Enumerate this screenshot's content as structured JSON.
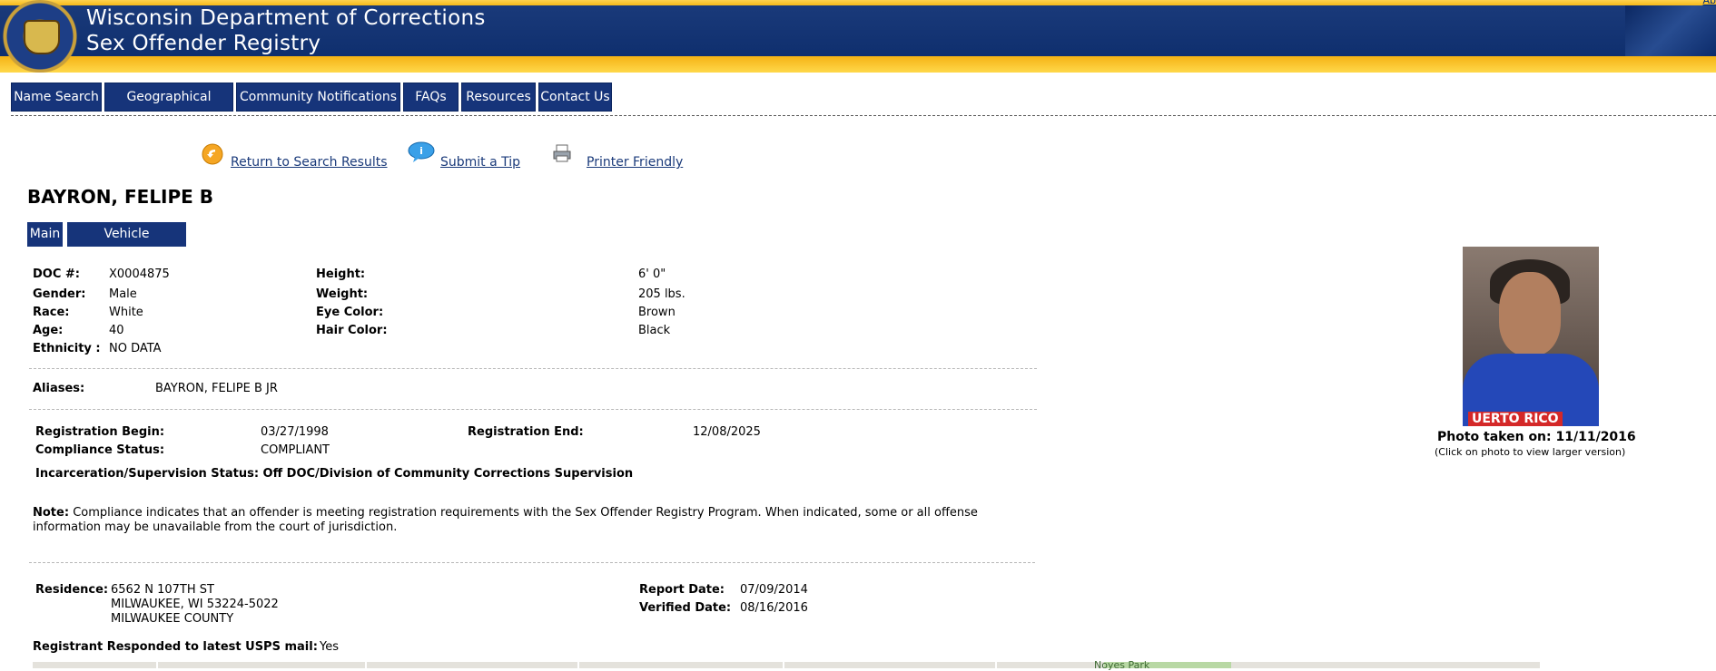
{
  "header": {
    "title_line1": "Wisconsin Department of Corrections",
    "title_line2": "Sex Offender Registry",
    "corner_link": "Ab",
    "colors": {
      "bar": "#0f2f6e",
      "stripe": "#f5b315"
    }
  },
  "nav": {
    "items": [
      "Name Search",
      "Geographical Search",
      "Community Notifications",
      "FAQs",
      "Resources",
      "Contact Us"
    ]
  },
  "actions": {
    "return_label": "Return to Search Results",
    "tip_label": "Submit a Tip",
    "print_label": "Printer Friendly"
  },
  "offender": {
    "name": "BAYRON, FELIPE B",
    "tabs": [
      "Main",
      "Vehicle Information"
    ],
    "doc_label": "DOC #:",
    "doc": "X0004875",
    "gender_label": "Gender:",
    "gender": "Male",
    "race_label": "Race:",
    "race": "White",
    "age_label": "Age:",
    "age": "40",
    "ethnicity_label": "Ethnicity :",
    "ethnicity": "NO DATA",
    "height_label": "Height:",
    "height": "6' 0\"",
    "weight_label": "Weight:",
    "weight": "205 lbs.",
    "eye_label": "Eye Color:",
    "eye": "Brown",
    "hair_label": "Hair Color:",
    "hair": "Black",
    "aliases_label": "Aliases:",
    "aliases": "BAYRON, FELIPE B JR",
    "reg_begin_label": "Registration Begin:",
    "reg_begin": "03/27/1998",
    "reg_end_label": "Registration End:",
    "reg_end": "12/08/2025",
    "compliance_label": "Compliance Status:",
    "compliance": "COMPLIANT",
    "incarceration": "Incarceration/Supervision Status: Off DOC/Division of Community Corrections Supervision",
    "note_label": "Note:",
    "note_line1": "Compliance indicates that an offender is meeting registration requirements with the Sex Offender Registry Program. When indicated, some or all offense",
    "note_line2": "information may be unavailable from the court of jurisdiction.",
    "residence_label": "Residence:",
    "residence_line1": "6562 N 107TH ST",
    "residence_line2": "MILWAUKEE, WI 53224-5022",
    "residence_line3": "MILWAUKEE COUNTY",
    "report_date_label": "Report Date:",
    "report_date": "07/09/2014",
    "verified_date_label": "Verified Date:",
    "verified_date": "08/16/2016",
    "usps_label": "Registrant Responded to latest USPS mail:",
    "usps": "Yes",
    "photo_date": "Photo taken on: 11/11/2016",
    "photo_hint": "(Click on photo to view larger version)",
    "photo_shirt_text": "UERTO RICO"
  },
  "map": {
    "park_label": "Noyes Park"
  }
}
